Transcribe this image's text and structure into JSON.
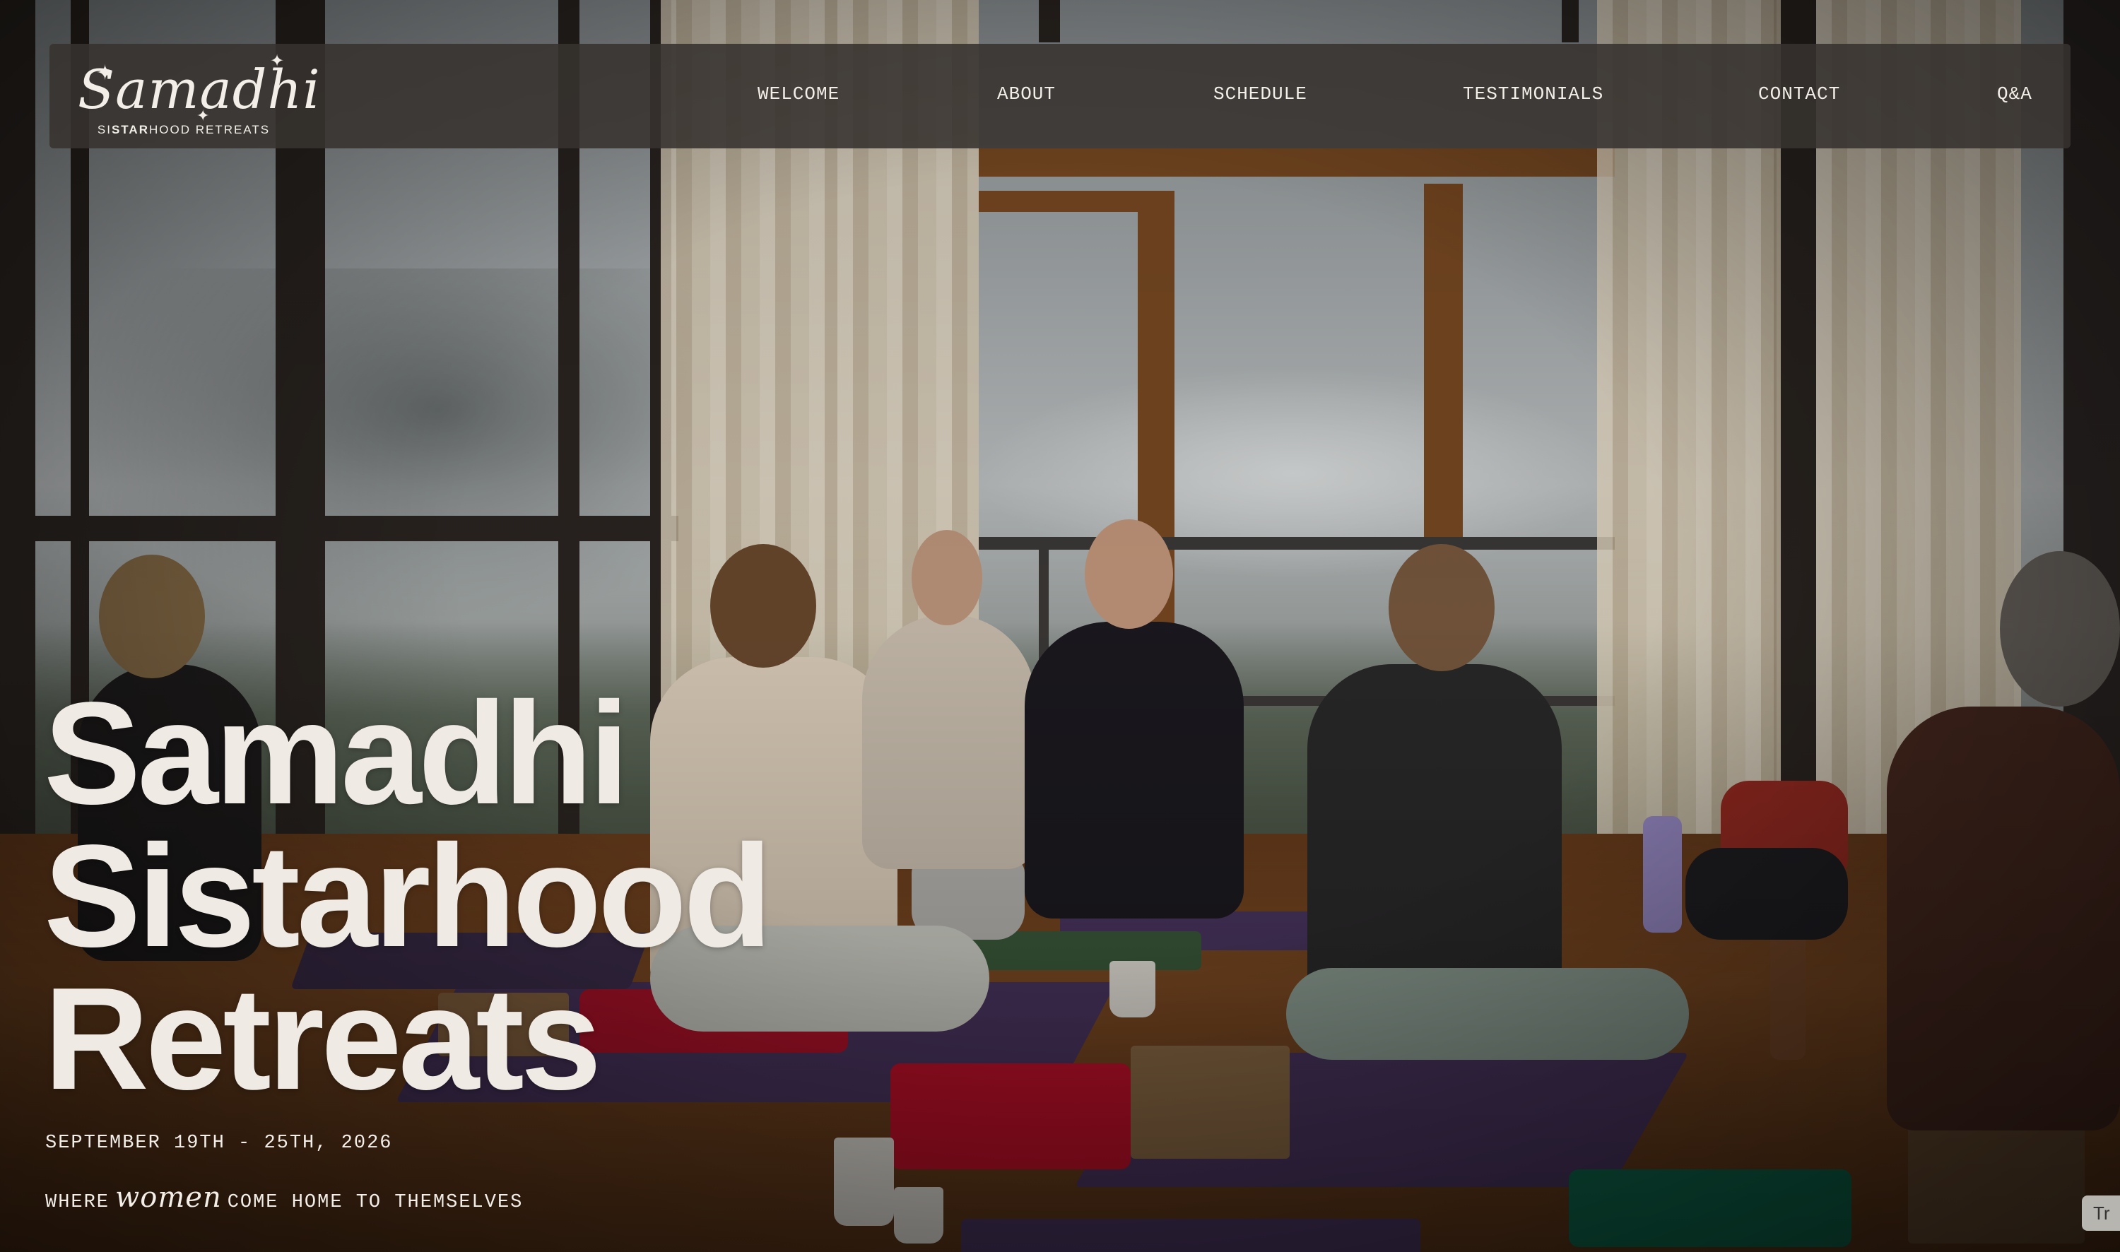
{
  "logo": {
    "script": "Samadhi",
    "subtitle_pre": "SI",
    "subtitle_star": "STAR",
    "subtitle_post": "HOOD RETREATS"
  },
  "nav": {
    "items": [
      "WELCOME",
      "ABOUT",
      "SCHEDULE",
      "TESTIMONIALS",
      "CONTACT",
      "Q&A"
    ]
  },
  "hero": {
    "title_lines": [
      "Samadhi",
      "Sistarhood",
      "Retreats"
    ],
    "date": "SEPTEMBER 19TH - 25TH, 2026",
    "tagline_pre": "WHERE",
    "tagline_script": "women",
    "tagline_post": "COME HOME TO THEMSELVES"
  },
  "translate_tab": "Tr",
  "colors": {
    "text": "#efebe4",
    "nav_bg": "#37322f",
    "mat": "#4a3560"
  }
}
